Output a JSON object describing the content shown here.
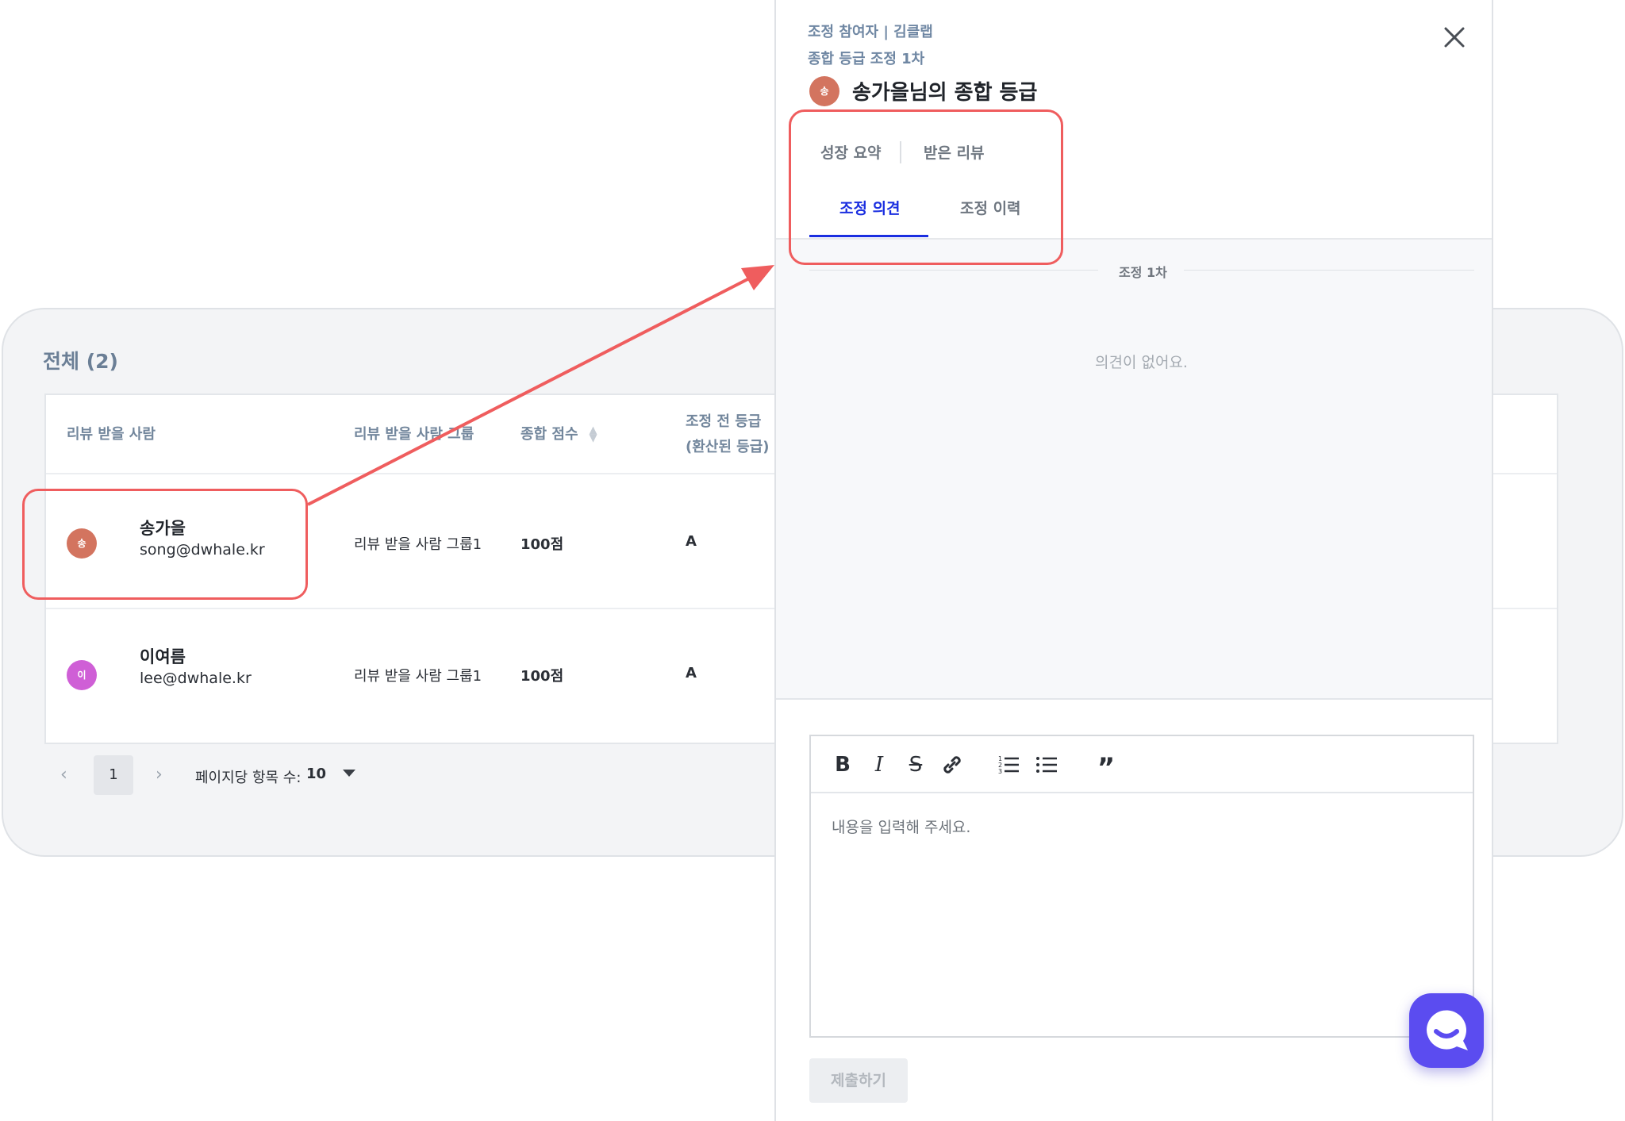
{
  "list": {
    "title": "전체 (2)",
    "columns": [
      "리뷰 받을 사람",
      "리뷰 받을 사람 그룹",
      "종합 점수",
      "조정 전 등급 (환산된 등급)"
    ],
    "rows": [
      {
        "avatar": "송",
        "avatar_color": "#d3745f",
        "name": "송가을",
        "email": "song@dwhale.kr",
        "group": "리뷰 받을 사람 그룹1",
        "score": "100점",
        "grade": "A"
      },
      {
        "avatar": "이",
        "avatar_color": "#cf5fd6",
        "name": "이여름",
        "email": "lee@dwhale.kr",
        "group": "리뷰 받을 사람 그룹1",
        "score": "100점",
        "grade": "A"
      }
    ],
    "pagination": {
      "page": "1",
      "per_page_label": "페이지당 항목 수:",
      "per_page": "10"
    }
  },
  "panel": {
    "meta_participant": "조정 참여자 | 김클랩",
    "meta_round": "종합 등급 조정 1차",
    "avatar": "송",
    "title": "송가을님의 종합 등급",
    "tabs": [
      {
        "label": "성장 요약",
        "active": false
      },
      {
        "label": "받은 리뷰",
        "active": false
      },
      {
        "label": "조정 의견",
        "active": true
      },
      {
        "label": "조정 이력",
        "active": false
      }
    ],
    "round_label": "조정 1차",
    "empty_message": "의견이 없어요.",
    "editor": {
      "placeholder": "내용을 입력해 주세요.",
      "toolbar": [
        "bold-icon",
        "italic-icon",
        "strikethrough-icon",
        "link-icon",
        "ordered-list-icon",
        "bullet-list-icon",
        "quote-icon"
      ]
    },
    "submit_label": "제출하기"
  },
  "colors": {
    "accent": "#1a2ee0",
    "highlight": "#ef5d5e",
    "chat": "#5b4cf0"
  }
}
